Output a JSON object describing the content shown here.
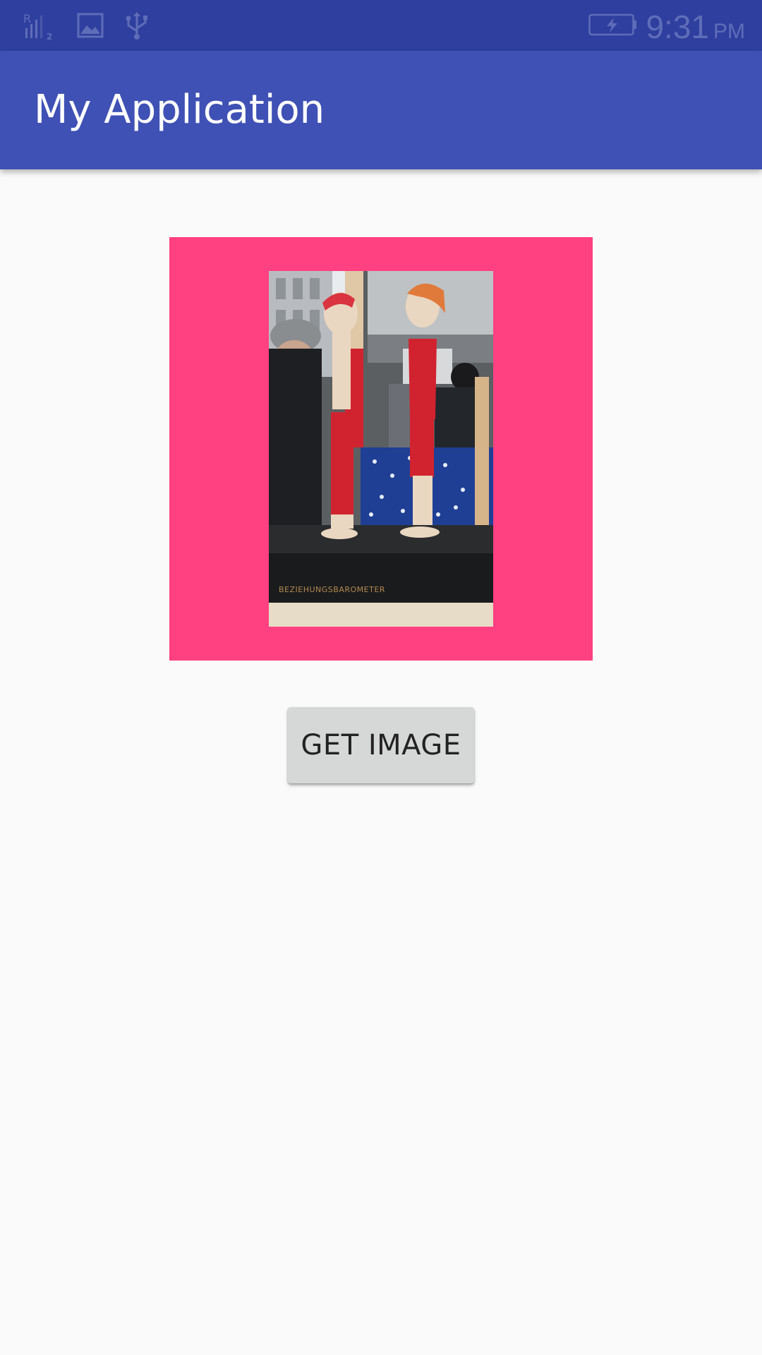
{
  "status_bar": {
    "signal_sub": "2",
    "time": "9:31",
    "ampm": "PM",
    "icons": [
      "signal-icon",
      "image-notification-icon",
      "usb-icon",
      "battery-charging-icon"
    ]
  },
  "app_bar": {
    "title": "My Application",
    "color": "#3f51b5"
  },
  "image_view": {
    "frame_color": "#ff4081",
    "photo_caption_text": "BEZIEHUNGSBAROMETER"
  },
  "actions": {
    "get_image_label": "GET IMAGE"
  },
  "colors": {
    "status_bar": "#2f3f9f",
    "background": "#fafafa",
    "button": "#d6d7d7"
  }
}
